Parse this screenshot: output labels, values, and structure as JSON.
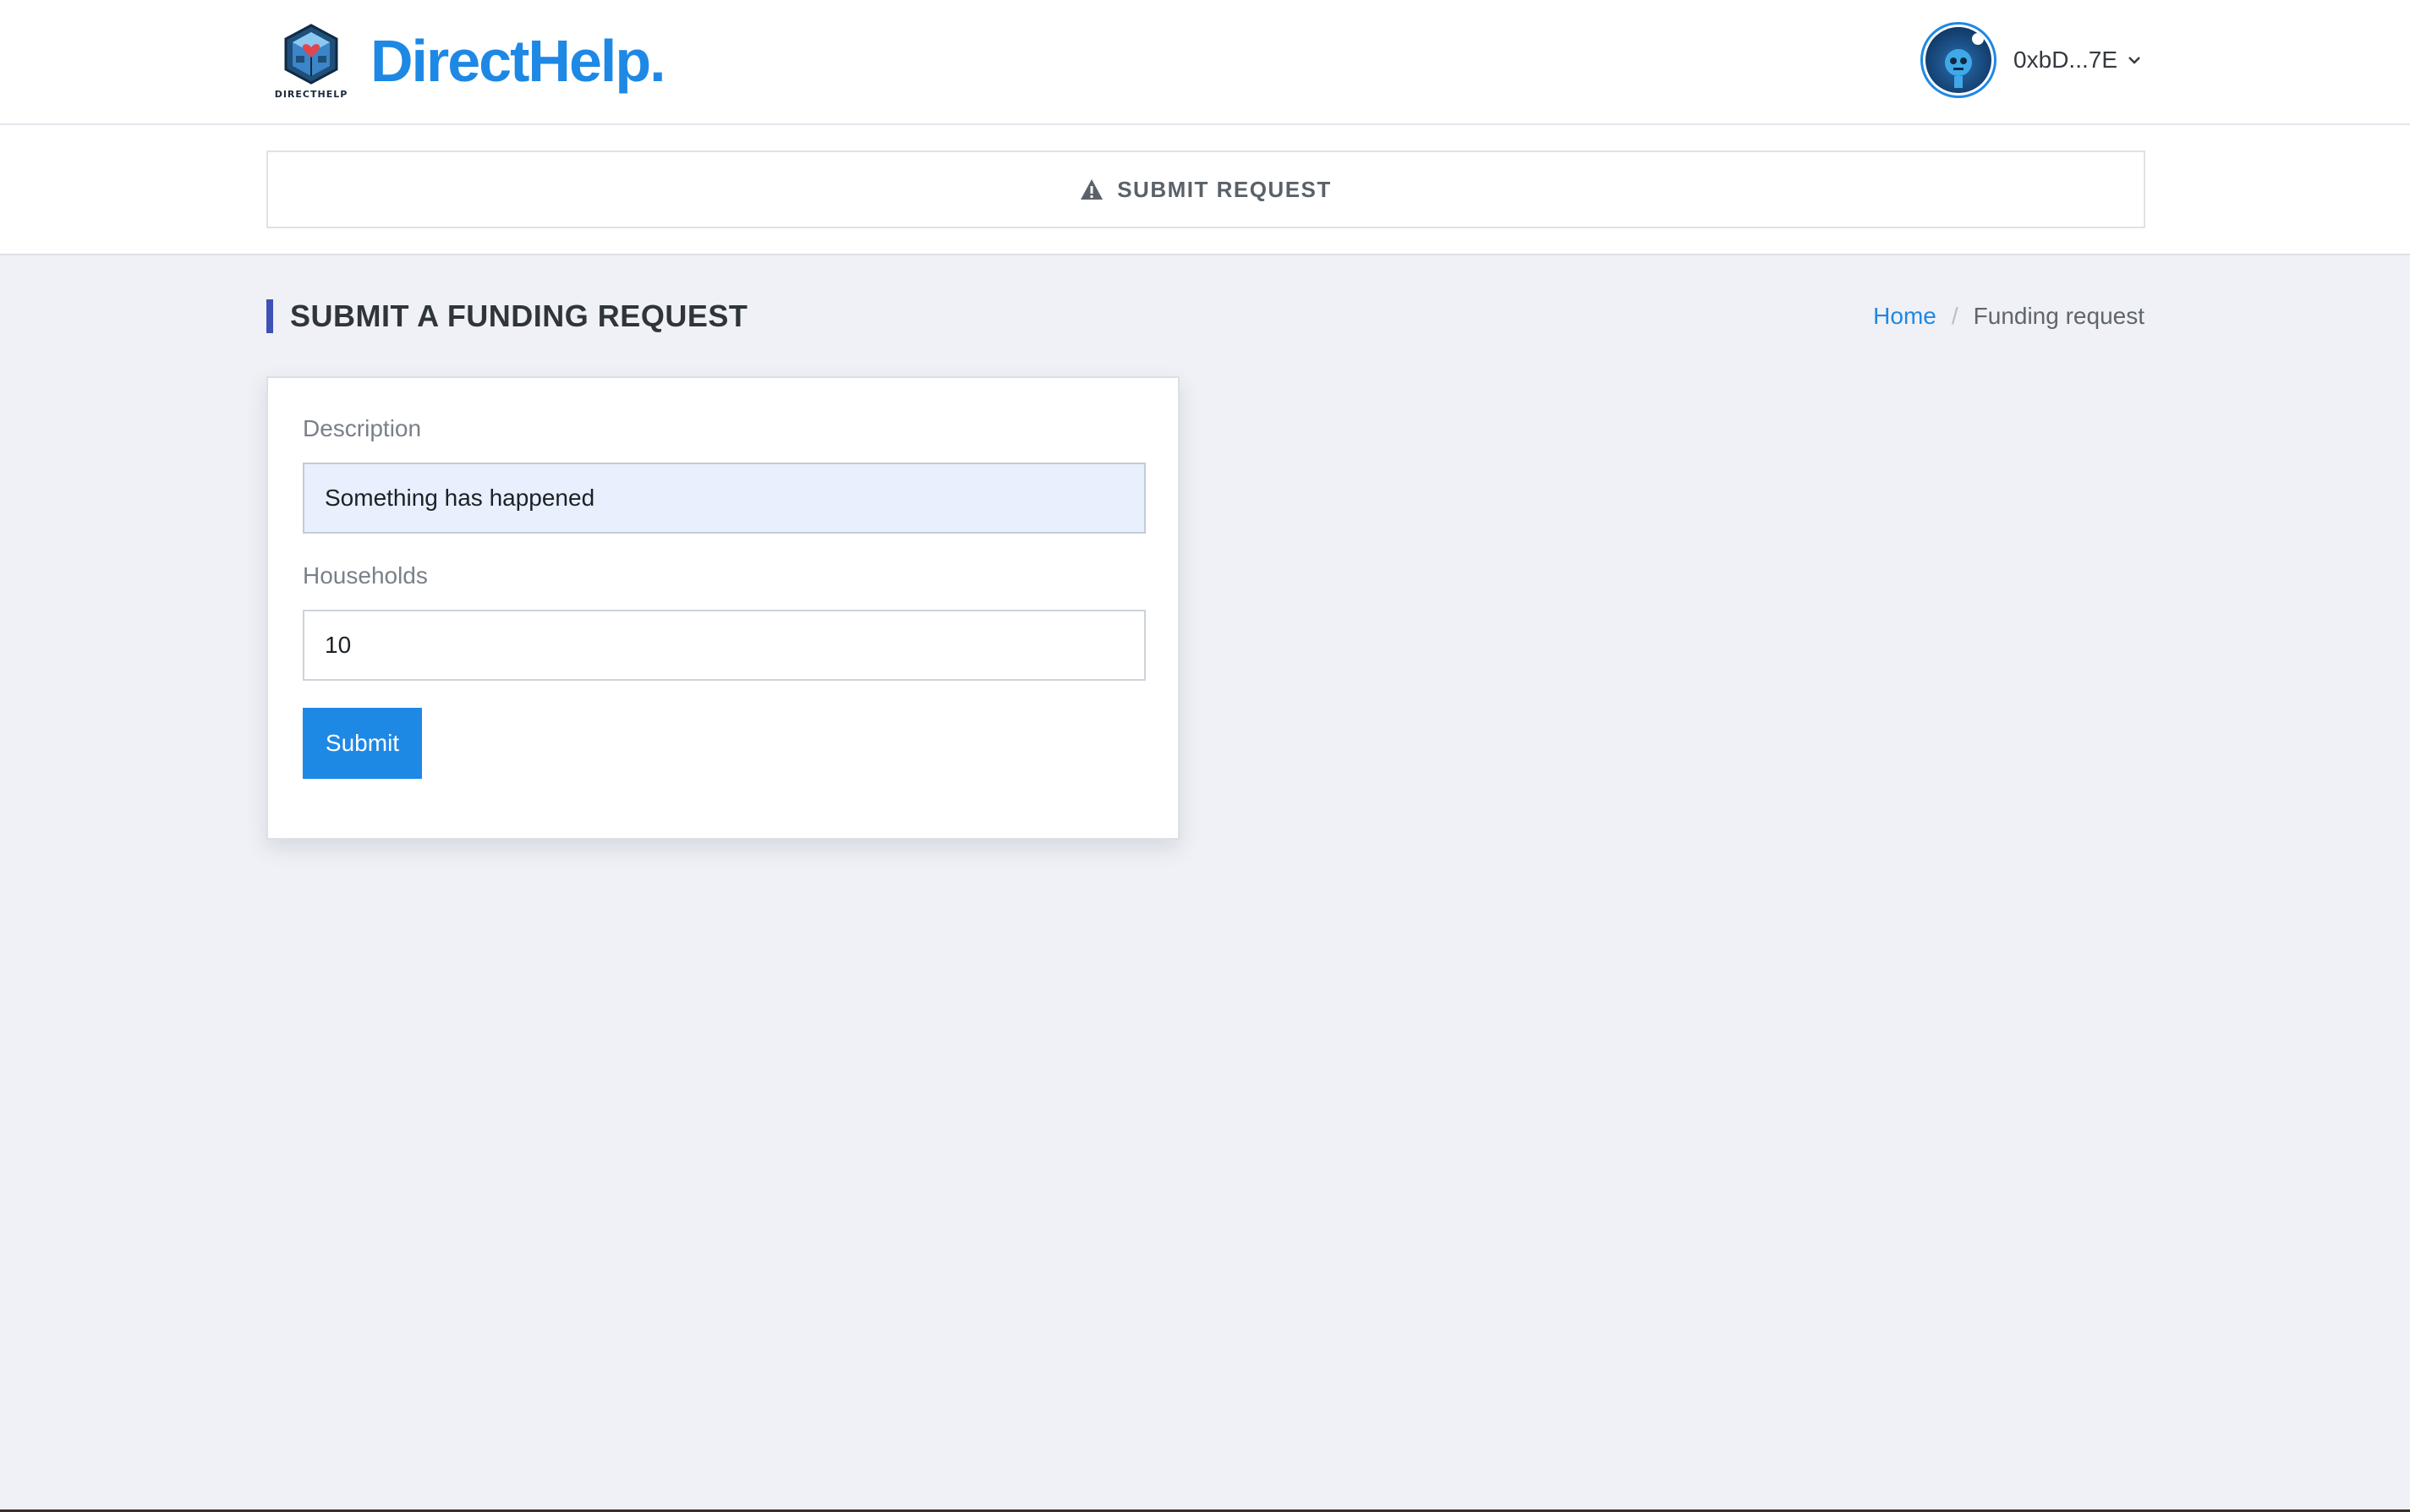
{
  "header": {
    "brand": "DirectHelp.",
    "logo_caption": "DIRECTHELP",
    "logo_icon": "heart-cube-logo-icon",
    "account_label": "0xbD...7E",
    "account_avatar": "robot-avatar-icon",
    "dropdown_icon": "chevron-down-icon"
  },
  "subnav": {
    "icon": "warning-triangle-icon",
    "label": "SUBMIT REQUEST"
  },
  "page": {
    "title": "SUBMIT A FUNDING REQUEST",
    "breadcrumb": {
      "home": "Home",
      "separator": "/",
      "current": "Funding request"
    }
  },
  "form": {
    "description_label": "Description",
    "description_value": "Something has happened",
    "households_label": "Households",
    "households_value": "10",
    "submit_label": "Submit"
  },
  "colors": {
    "brand_blue": "#1e88e5",
    "title_accent": "#3f51b5",
    "page_background": "#eff1f6",
    "autofill_background": "#e8f0fe"
  }
}
